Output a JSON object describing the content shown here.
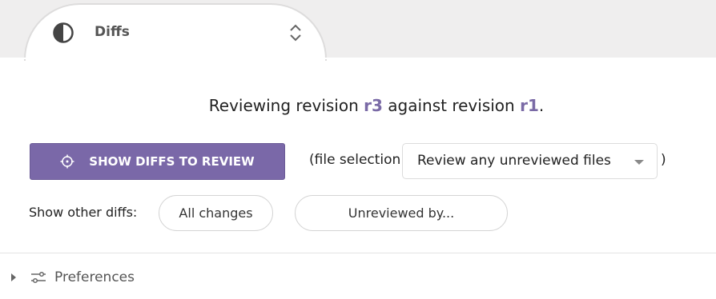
{
  "tab": {
    "label": "Diffs",
    "icon": "contrast-icon",
    "chevron_icon": "unfold-chevrons-icon"
  },
  "heading": {
    "prefix": "Reviewing revision ",
    "revision": "r3",
    "middle": " against revision ",
    "base": "r1",
    "suffix": "."
  },
  "review_button": {
    "label": "SHOW DIFFS TO REVIEW",
    "icon": "crosshair-icon"
  },
  "file_selection": {
    "open_text": "(file selection:",
    "value": "Review any unreviewed files",
    "close_text": ")"
  },
  "other_diffs": {
    "label": "Show other diffs:",
    "all_changes": "All changes",
    "unreviewed_by": "Unreviewed by..."
  },
  "preferences": {
    "label": "Preferences",
    "icon": "sliders-icon"
  },
  "colors": {
    "accent": "#7a68a8",
    "revision_text": "#7a6aa6",
    "tab_strip": "#efeeee"
  }
}
